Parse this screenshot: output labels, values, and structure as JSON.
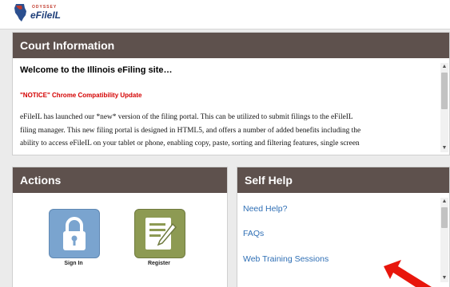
{
  "header": {
    "logo_top": "ODYSSEY",
    "logo_main": "eFileIL"
  },
  "court": {
    "title": "Court Information",
    "welcome": "Welcome to the Illinois eFiling site…",
    "notice": "\"NOTICE\" Chrome Compatibility Update",
    "paragraph_lines": [
      "eFileIL has launched our *new* version of the filing portal.  This can be utilized to submit filings to the eFileIL",
      "filing manager.  This new filing portal is designed in HTML5, and offers a number of added benefits including the",
      "ability to access eFileIL on your tablet or phone, enabling copy, paste, sorting and filtering features, single screen"
    ]
  },
  "actions": {
    "title": "Actions",
    "signin_label": "Sign In",
    "register_label": "Register"
  },
  "selfhelp": {
    "title": "Self Help",
    "links": [
      "Need Help?",
      "FAQs",
      "Web Training Sessions"
    ]
  },
  "icons": {
    "signin": "lock-icon",
    "register": "document-pen-icon",
    "pointer": "red-arrow-icon"
  },
  "colors": {
    "panel_header": "#5e514d",
    "link": "#2f6fb5",
    "notice": "#d40000",
    "signin_tile": "#7aa4cf",
    "register_tile": "#8d9a53",
    "arrow": "#e8160c"
  }
}
